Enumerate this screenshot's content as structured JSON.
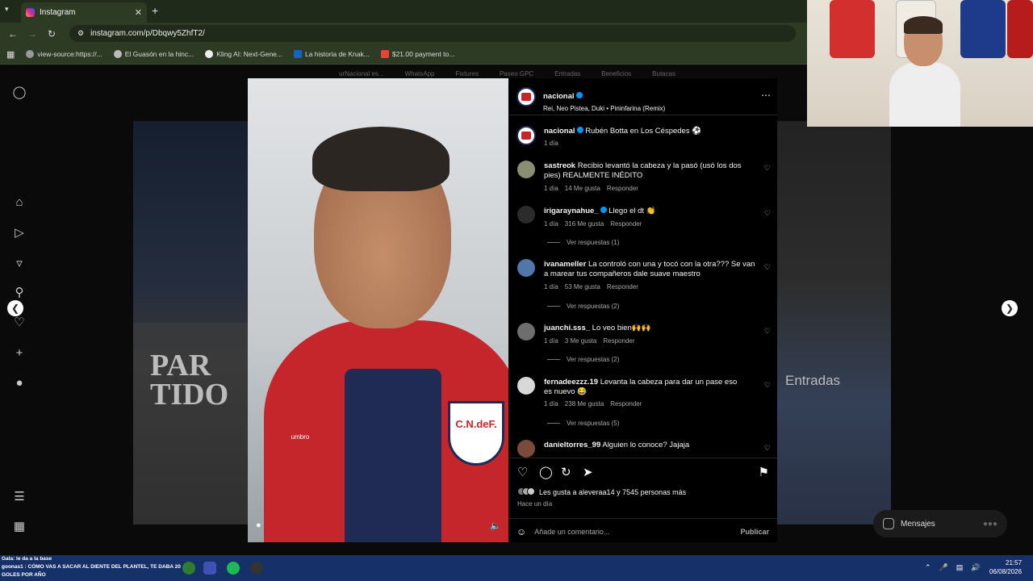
{
  "browser": {
    "tab_title": "Instagram",
    "url": "instagram.com/p/Dbqwy5ZhfT2/",
    "bookmarks": [
      {
        "label": "view-source:https://..."
      },
      {
        "label": "El Guasón en la hinc..."
      },
      {
        "label": "Kling AI: Next-Gene..."
      },
      {
        "label": "La historia de Knak..."
      },
      {
        "label": "$21.00 payment to..."
      }
    ]
  },
  "background_nav": [
    "urNacional es...",
    "WhatsApp",
    "Fixtures",
    "Paseo GPC",
    "Entradas",
    "Beneficios",
    "Butacas"
  ],
  "background_text": {
    "left": "PAR TIDO",
    "right": "Entradas"
  },
  "photo": {
    "crest_text": "C.N.deF.",
    "brand": "umbro"
  },
  "post": {
    "author": "nacional",
    "audio": "Rei, Neo Pistea, Duki • Pininfarina (Remix)",
    "caption_user": "nacional",
    "caption_text": "Rubén Botta en Los Céspedes ⚽",
    "caption_time": "1 día",
    "comments": [
      {
        "user": "sastreok",
        "verified": false,
        "text": "Recibio levantó la cabeza y la pasó (usó los dos pies) REALMENTE INÉDITO",
        "time": "1 día",
        "likes": "14 Me gusta",
        "reply": "Responder",
        "replies": ""
      },
      {
        "user": "irigaraynahue_",
        "verified": true,
        "text": "Llego el dt 👏",
        "time": "1 día",
        "likes": "316 Me gusta",
        "reply": "Responder",
        "replies": "Ver respuestas (1)"
      },
      {
        "user": "ivanameller",
        "verified": false,
        "text": "La controló con una y tocó con la otra??? Se van a marear tus compañeros dale suave maestro",
        "time": "1 día",
        "likes": "53 Me gusta",
        "reply": "Responder",
        "replies": "Ver respuestas (2)"
      },
      {
        "user": "juanchi.sss_",
        "verified": false,
        "text": "Lo veo bien🙌🙌",
        "time": "1 día",
        "likes": "3 Me gusta",
        "reply": "Responder",
        "replies": "Ver respuestas (2)"
      },
      {
        "user": "fernadeezzz.19",
        "verified": false,
        "text": "Levanta la cabeza para dar un pase eso es nuevo 😂",
        "time": "1 día",
        "likes": "238 Me gusta",
        "reply": "Responder",
        "replies": "Ver respuestas (5)"
      },
      {
        "user": "danieltorres_99",
        "verified": false,
        "text": "Alguien lo conoce? Jajaja",
        "time": "",
        "likes": "",
        "reply": "",
        "replies": ""
      }
    ],
    "likes_text": "Les gusta a aleveraa14 y 7545 personas más",
    "posted": "Hace un día",
    "comment_placeholder": "Añade un comentario...",
    "publish_label": "Publicar"
  },
  "messages_label": "Mensajes",
  "taskbar": {
    "overlay_line1": "Gala: le da a la base",
    "overlay_line2": "goonas1 : CÓMO VAS A SACAR AL DIENTE DEL PLANTEL, TE DABA 20",
    "overlay_line3": "GOLES POR AÑO",
    "time": "21:57",
    "date": "06/08/2026"
  }
}
